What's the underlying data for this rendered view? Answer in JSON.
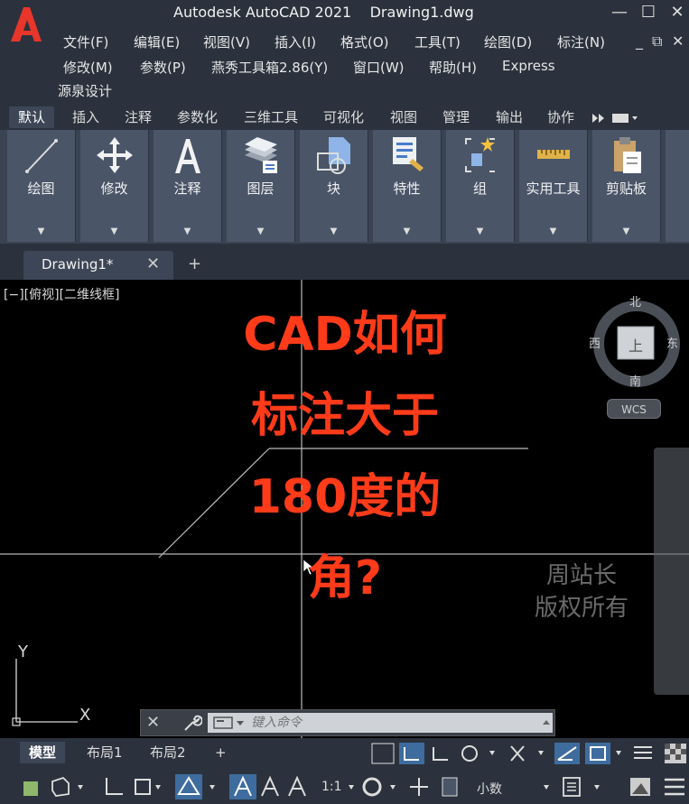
{
  "app": {
    "title": "Autodesk AutoCAD 2021",
    "file": "Drawing1.dwg",
    "logo_letter": "A"
  },
  "window_controls": {
    "minimize": "—",
    "maximize": "☐",
    "close": "✕"
  },
  "mdi_controls": {
    "minimize": "_",
    "restore": "⧉",
    "close": "✕"
  },
  "menu": {
    "row1": [
      "文件(F)",
      "编辑(E)",
      "视图(V)",
      "插入(I)",
      "格式(O)",
      "工具(T)",
      "绘图(D)",
      "标注(N)"
    ],
    "row2": [
      "修改(M)",
      "参数(P)",
      "燕秀工具箱2.86(Y)",
      "窗口(W)",
      "帮助(H)",
      "Express"
    ],
    "row3": [
      "源泉设计"
    ]
  },
  "ribbon_tabs": [
    "默认",
    "插入",
    "注释",
    "参数化",
    "三维工具",
    "可视化",
    "视图",
    "管理",
    "输出",
    "协作"
  ],
  "ribbon_buttons": [
    {
      "label": "绘图",
      "icon": "line-draw-icon"
    },
    {
      "label": "修改",
      "icon": "move-arrows-icon"
    },
    {
      "label": "注释",
      "icon": "text-a-icon"
    },
    {
      "label": "图层",
      "icon": "layers-icon"
    },
    {
      "label": "块",
      "icon": "block-icon"
    },
    {
      "label": "特性",
      "icon": "properties-icon"
    },
    {
      "label": "组",
      "icon": "group-icon"
    },
    {
      "label": "实用工具",
      "icon": "ruler-icon"
    },
    {
      "label": "剪贴板",
      "icon": "clipboard-icon"
    }
  ],
  "doc_tab": {
    "label": "Drawing1*",
    "close": "✕",
    "add": "+"
  },
  "viewport_label": "[−][俯视][二维线框]",
  "overlay_text": [
    "CAD如何",
    "标注大于",
    "180度的",
    "角?"
  ],
  "watermark": [
    "周站长",
    "版权所有"
  ],
  "viewcube": {
    "north": "北",
    "south": "南",
    "east": "东",
    "west": "西",
    "face": "上",
    "wcs": "WCS"
  },
  "ucs": {
    "x": "X",
    "y": "Y"
  },
  "command_line": {
    "placeholder": "键入命令",
    "close": "✕"
  },
  "layout_tabs": [
    "模型",
    "布局1",
    "布局2"
  ],
  "layout_add": "+",
  "status": {
    "scale": "1:1",
    "units": "小数"
  },
  "colors": {
    "accent_red": "#ff3b1a",
    "ribbon": "#4a5568",
    "chrome": "#2b323d",
    "status_on": "#3e6c9e"
  }
}
